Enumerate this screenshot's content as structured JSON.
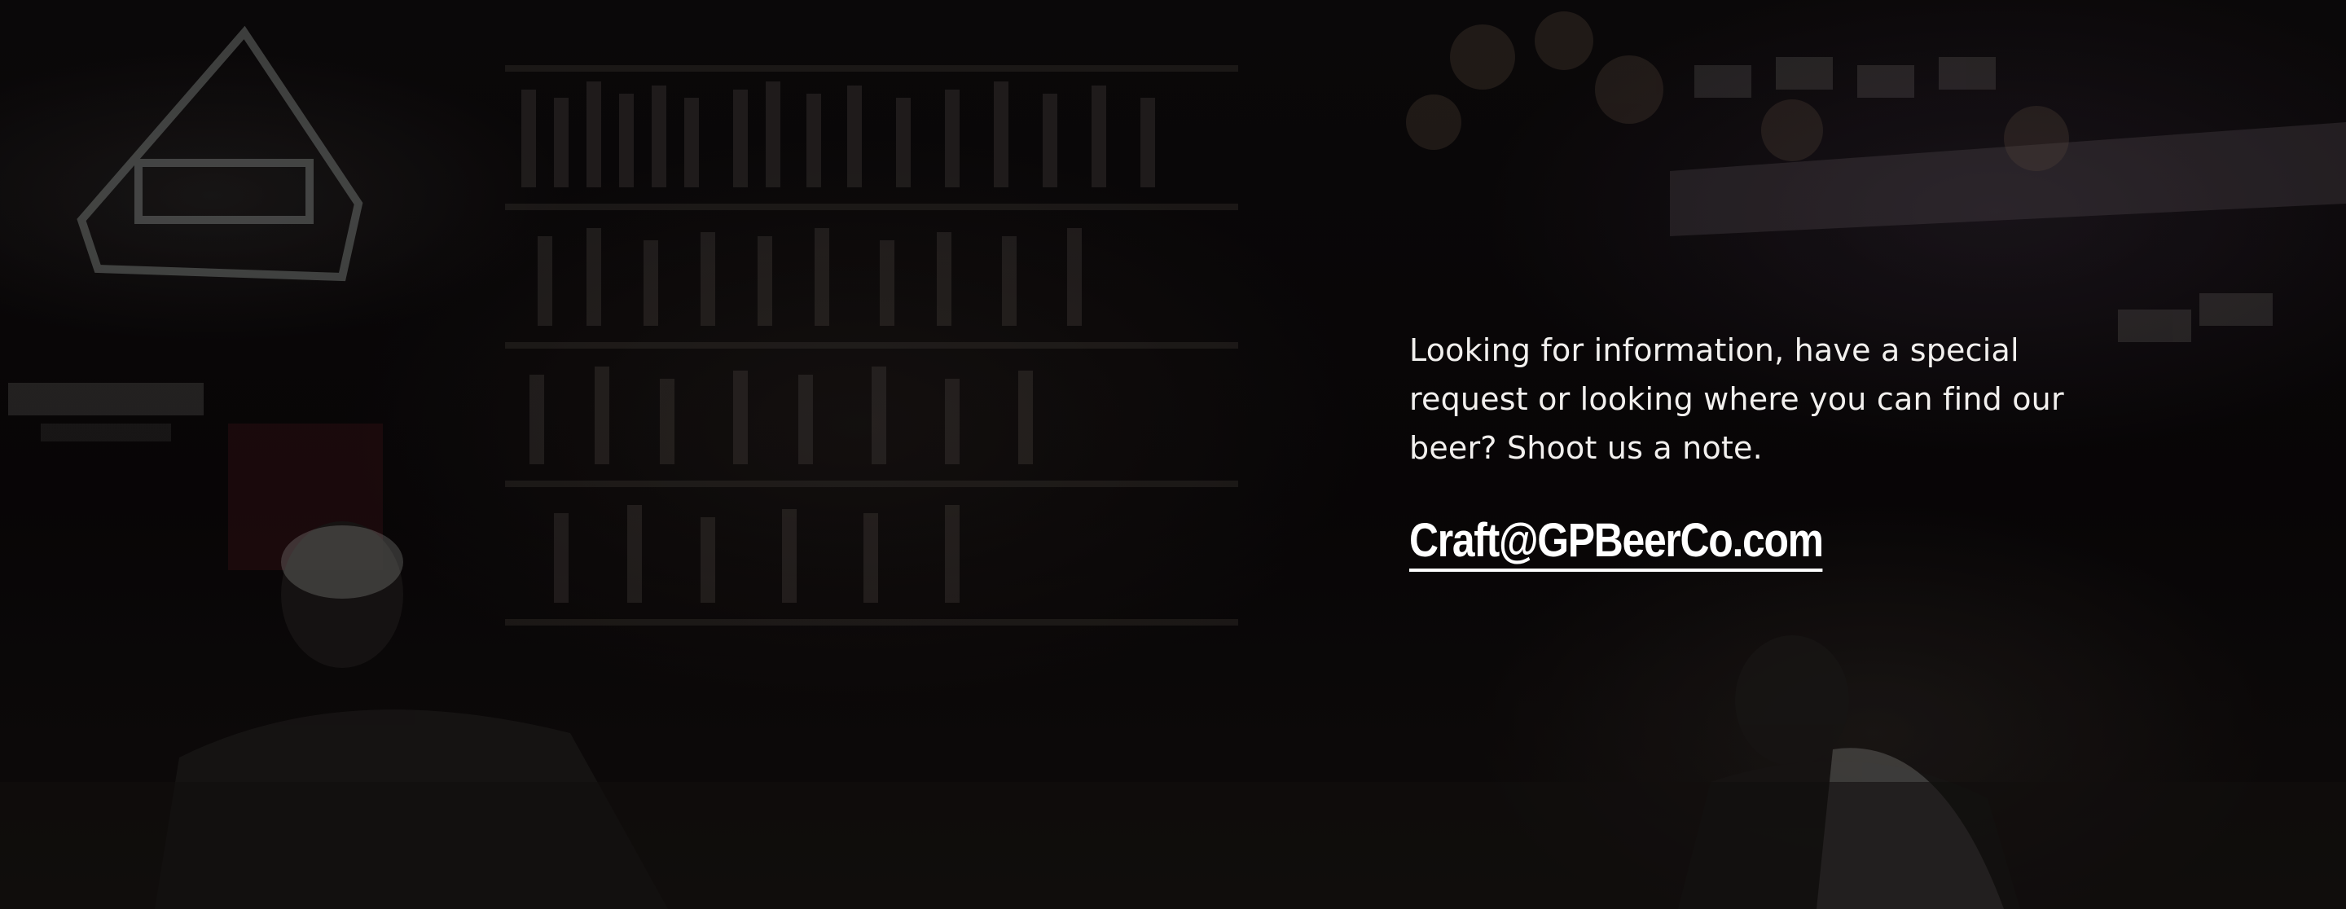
{
  "contact": {
    "intro": "Looking for information, have a special request or looking where you can find our beer? Shoot us a note.",
    "email": "Craft@GPBeerCo.com"
  }
}
